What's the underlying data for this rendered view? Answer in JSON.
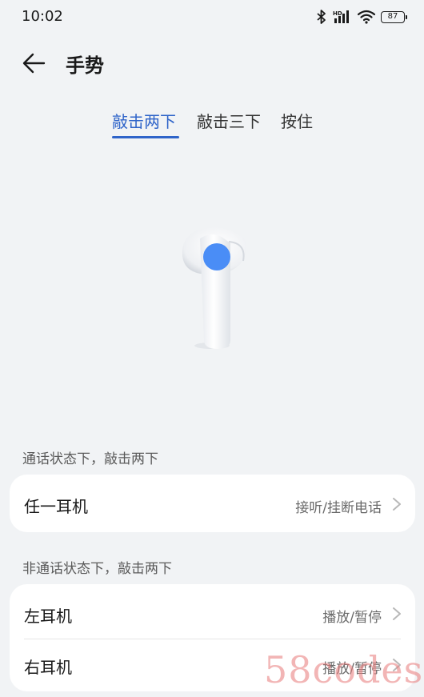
{
  "status_bar": {
    "time": "10:02",
    "network_label": "HD",
    "battery_level": "87"
  },
  "header": {
    "title": "手势"
  },
  "tabs": [
    {
      "label": "敲击两下",
      "active": true
    },
    {
      "label": "敲击三下",
      "active": false
    },
    {
      "label": "按住",
      "active": false
    }
  ],
  "sections": [
    {
      "label": "通话状态下，敲击两下",
      "rows": [
        {
          "label": "任一耳机",
          "value": "接听/挂断电话"
        }
      ]
    },
    {
      "label": "非通话状态下，敲击两下",
      "rows": [
        {
          "label": "左耳机",
          "value": "播放/暂停"
        },
        {
          "label": "右耳机",
          "value": "播放/暂停"
        }
      ]
    }
  ],
  "watermark": "58codes",
  "colors": {
    "accent": "#2f64c9",
    "tap_dot": "#4a8df6",
    "background": "#f1f3f5",
    "card": "#ffffff"
  }
}
